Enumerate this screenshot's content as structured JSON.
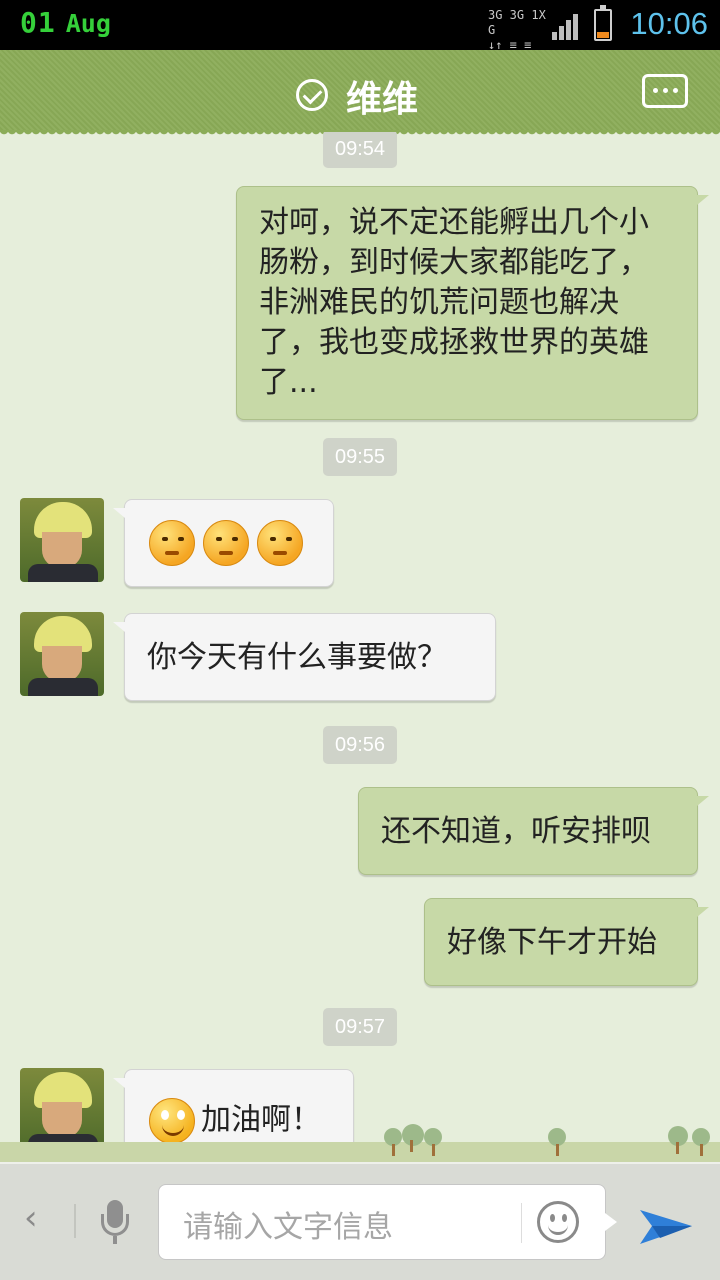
{
  "status_bar": {
    "date_day": "01",
    "date_month": "Aug",
    "network_line1": "3G 3G 1X G",
    "network_line2": "↓↑ ≡ ≡",
    "time": "10:06",
    "battery_color": "#f08a1e",
    "time_color": "#5ec2ec"
  },
  "header": {
    "title": "维维",
    "verified_icon": "check-circle-icon",
    "more_icon": "more-dots-icon",
    "color": "#8bac58"
  },
  "messages": [
    {
      "type": "time",
      "text": "09:54"
    },
    {
      "type": "out",
      "text": "对呵，说不定还能孵出几个小肠粉，到时候大家都能吃了，非洲难民的饥荒问题也解决了，我也变成拯救世界的英雄了..."
    },
    {
      "type": "time",
      "text": "09:55"
    },
    {
      "type": "in",
      "content": "emoji",
      "emojis": [
        "angry-emoji",
        "shy-emoji",
        "shy-emoji"
      ]
    },
    {
      "type": "in",
      "text": "你今天有什么事要做？"
    },
    {
      "type": "time",
      "text": "09:56"
    },
    {
      "type": "out",
      "text": "还不知道，听安排呗"
    },
    {
      "type": "out",
      "text": "好像下午才开始"
    },
    {
      "type": "time",
      "text": "09:57"
    },
    {
      "type": "in",
      "text": "加油啊！",
      "emoji": "smile-emoji"
    }
  ],
  "input_bar": {
    "back_icon": "chevron-left-icon",
    "mic_icon": "microphone-icon",
    "placeholder": "请输入文字信息",
    "emoji_icon": "smiley-icon",
    "send_icon": "send-icon"
  }
}
